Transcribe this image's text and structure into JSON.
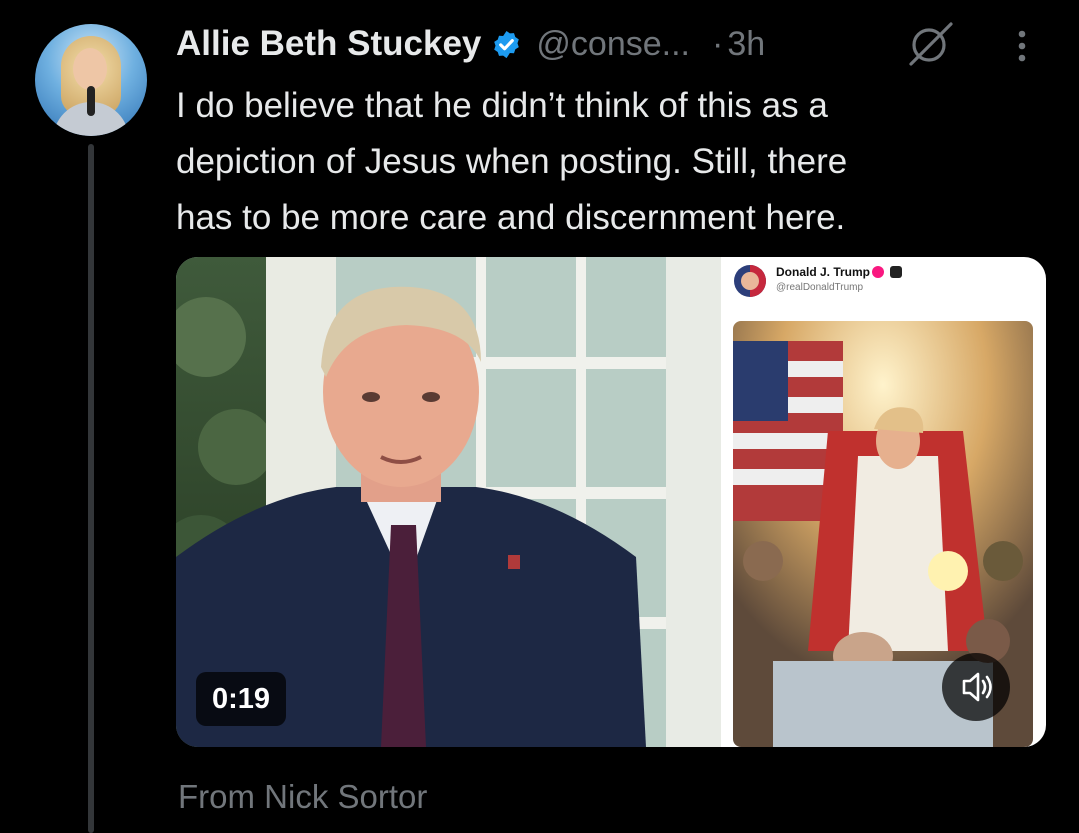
{
  "tweet": {
    "author_name": "Allie Beth Stuckey",
    "handle": "@conse...",
    "separator": "·",
    "time": "3h",
    "text_lines": [
      "I do believe that he didn’t think of this as a",
      "depiction of Jesus when posting. Still, there",
      "has to be more care and discernment here."
    ]
  },
  "media": {
    "video_duration": "0:19",
    "embedded_post": {
      "name": "Donald J. Trump",
      "handle": "@realDonaldTrump"
    }
  },
  "attribution": "From Nick Sortor",
  "colors": {
    "background": "#000000",
    "text_primary": "#e7e9ea",
    "text_secondary": "#71767b",
    "verified_blue": "#1d9bf0",
    "thread_line": "#333639"
  },
  "icons": [
    "verified-badge-icon",
    "grok-icon",
    "more-options-icon",
    "volume-icon"
  ]
}
